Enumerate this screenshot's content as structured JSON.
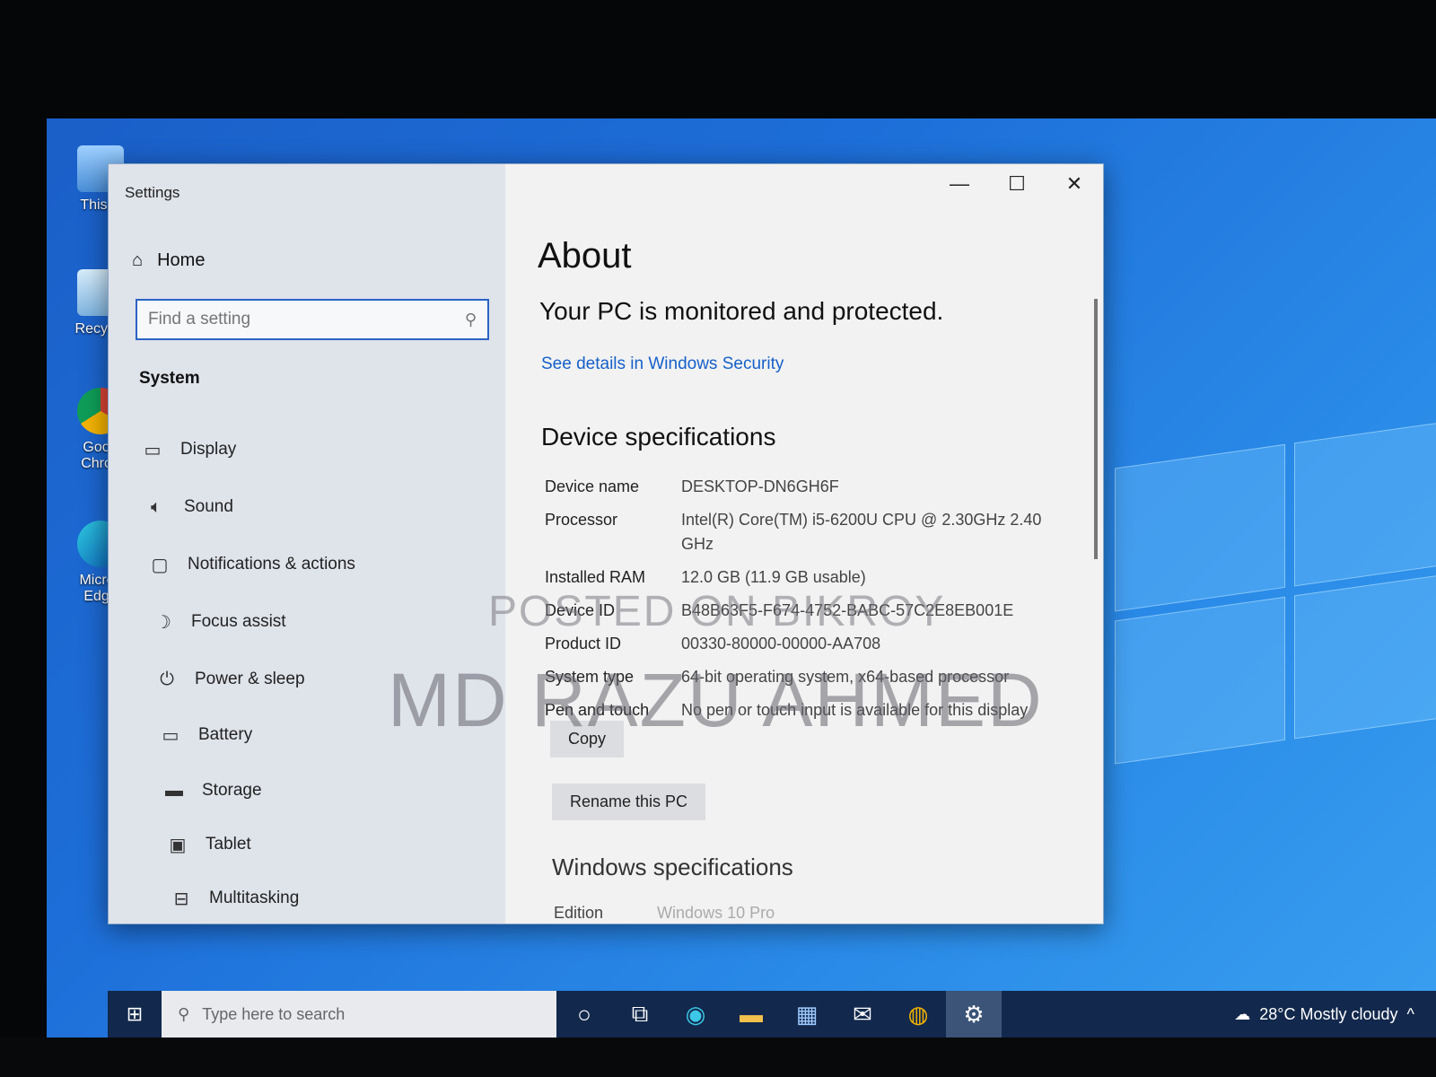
{
  "desktop": {
    "icons": [
      {
        "label": "This P",
        "icon": "computer-icon"
      },
      {
        "label": "Recycle",
        "icon": "recycle-bin-icon"
      },
      {
        "label": "Goog Chron",
        "icon": "chrome-icon"
      },
      {
        "label": "Micros Edge",
        "icon": "edge-icon"
      }
    ]
  },
  "window": {
    "title": "Settings",
    "controls": {
      "minimize": "—",
      "maximize": "☐",
      "close": "✕"
    }
  },
  "sidebar": {
    "home_label": "Home",
    "search_placeholder": "Find a setting",
    "section": "System",
    "items": [
      {
        "label": "Display",
        "icon": "monitor-icon"
      },
      {
        "label": "Sound",
        "icon": "speaker-icon"
      },
      {
        "label": "Notifications & actions",
        "icon": "notification-icon"
      },
      {
        "label": "Focus assist",
        "icon": "moon-icon"
      },
      {
        "label": "Power & sleep",
        "icon": "power-icon"
      },
      {
        "label": "Battery",
        "icon": "battery-icon"
      },
      {
        "label": "Storage",
        "icon": "storage-icon"
      },
      {
        "label": "Tablet",
        "icon": "tablet-icon"
      },
      {
        "label": "Multitasking",
        "icon": "multitasking-icon"
      }
    ]
  },
  "content": {
    "title": "About",
    "protected_text": "Your PC is monitored and protected.",
    "security_link": "See details in Windows Security",
    "device_specs_heading": "Device specifications",
    "specs": [
      {
        "key": "Device name",
        "value": "DESKTOP-DN6GH6F"
      },
      {
        "key": "Processor",
        "value": "Intel(R) Core(TM) i5-6200U CPU @ 2.30GHz   2.40 GHz"
      },
      {
        "key": "Installed RAM",
        "value": "12.0 GB (11.9 GB usable)"
      },
      {
        "key": "Device ID",
        "value": "B48B63F5-F674-4752-BABC-57C2E8EB001E"
      },
      {
        "key": "Product ID",
        "value": "00330-80000-00000-AA708"
      },
      {
        "key": "System type",
        "value": "64-bit operating system, x64-based processor"
      },
      {
        "key": "Pen and touch",
        "value": "No pen or touch input is available for this display"
      }
    ],
    "copy_button": "Copy",
    "rename_button": "Rename this PC",
    "windows_specs_heading": "Windows specifications",
    "edition_key": "Edition",
    "edition_value": "Windows 10 Pro"
  },
  "watermark": {
    "line1": "POSTED ON BIKROY",
    "line2": "MD RAZU AHMED"
  },
  "taskbar": {
    "search_placeholder": "Type here to search",
    "apps": [
      "cortana-icon",
      "task-view-icon",
      "edge-icon",
      "file-explorer-icon",
      "store-icon",
      "mail-icon",
      "chrome-icon",
      "settings-icon"
    ],
    "weather": "28°C  Mostly cloudy"
  }
}
